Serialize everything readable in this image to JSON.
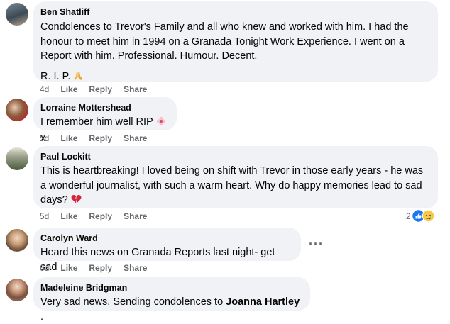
{
  "comments": [
    {
      "author": "Ben Shatliff",
      "lines": [
        "Condolences to Trevor's Family and all who knew and worked with him. I had the",
        "honour to meet him in 1994 on a Granada Tonight Work Experience. I went on a",
        "Report with him. Professional. Humour. Decent."
      ],
      "extra": "R. I. P.",
      "time": "4d"
    },
    {
      "author": "Lorraine Mottershead",
      "text": "I remember him well RIP",
      "suffix": "x",
      "time": "5d"
    },
    {
      "author": "Paul Lockitt",
      "lines": [
        "This is heartbreaking! I loved being on shift with Trevor in those early years - he was",
        "a wonderful journalist, with such a warm heart. Why do happy memories lead to sad",
        "days?"
      ],
      "time": "5d",
      "reaction_count": "2"
    },
    {
      "author": "Carolyn Ward",
      "text": "Heard this news on Granada Reports last night- get sad",
      "time": "6d"
    },
    {
      "author": "Madeleine Bridgman",
      "text": "Very sad news. Sending condolences to",
      "mention": "Joanna Hartley",
      "suffix": "."
    }
  ],
  "actions": {
    "like": "Like",
    "reply": "Reply",
    "share": "Share"
  },
  "more_label": "···",
  "icons": {
    "prayer": "folded-hands-icon",
    "flower": "flower-icon",
    "broken_heart": "broken-heart-icon",
    "like_reaction": "like-reaction-icon",
    "sad_reaction": "sad-reaction-icon",
    "more": "more-options-icon"
  },
  "colors": {
    "bubble": "#f0f2f5",
    "meta": "#65676b",
    "text": "#050505",
    "like_blue": "#1877f2"
  }
}
